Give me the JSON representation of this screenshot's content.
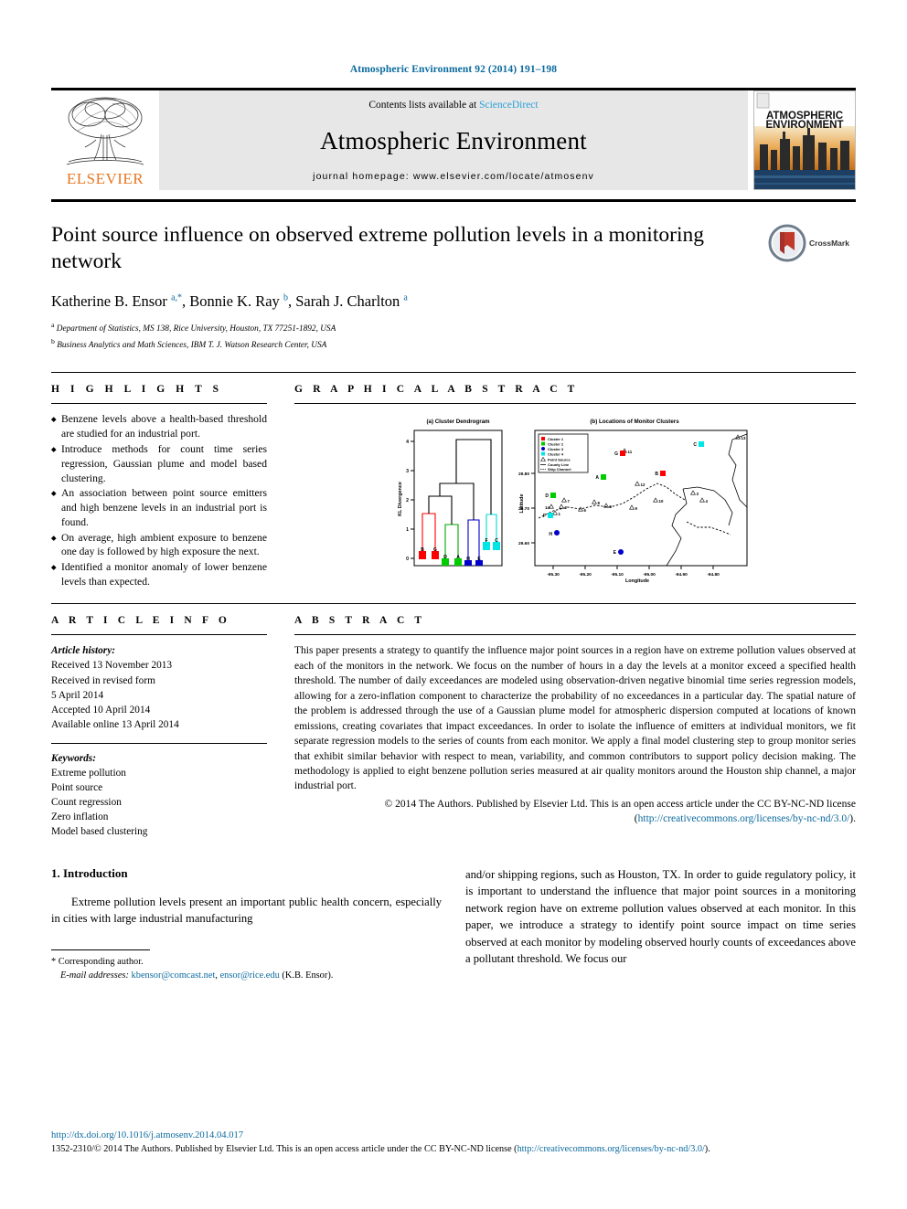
{
  "runhead": "Atmospheric Environment 92 (2014) 191–198",
  "masthead": {
    "publisher": "ELSEVIER",
    "contents_prefix": "Contents lists available at ",
    "contents_link": "ScienceDirect",
    "journal_name": "Atmospheric Environment",
    "homepage": "journal homepage: www.elsevier.com/locate/atmosenv",
    "cover_line1": "ATMOSPHERIC",
    "cover_line2": "ENVIRONMENT"
  },
  "article": {
    "title": "Point source influence on observed extreme pollution levels in a monitoring network",
    "authors_html": "Katherine B. Ensor <sup>a,*</sup>, Bonnie K. Ray <sup>b</sup>, Sarah J. Charlton <sup>a</sup>",
    "affiliation_a": "Department of Statistics, MS 138, Rice University, Houston, TX 77251-1892, USA",
    "affiliation_b": "Business Analytics and Math Sciences, IBM T. J. Watson Research Center, USA",
    "crossmark_label": "CrossMark"
  },
  "highlights": {
    "heading": "H I G H L I G H T S",
    "items": [
      "Benzene levels above a health-based threshold are studied for an industrial port.",
      "Introduce methods for count time series regression, Gaussian plume and model based clustering.",
      "An association between point source emitters and high benzene levels in an industrial port is found.",
      "On average, high ambient exposure to benzene one day is followed by high exposure the next.",
      "Identified a monitor anomaly of lower benzene levels than expected."
    ]
  },
  "graphical_abstract": {
    "heading": "G R A P H I C A L   A B S T R A C T"
  },
  "article_info": {
    "heading": "A R T I C L E   I N F O",
    "history_label": "Article history:",
    "history": [
      "Received 13 November 2013",
      "Received in revised form",
      "5 April 2014",
      "Accepted 10 April 2014",
      "Available online 13 April 2014"
    ],
    "keywords_label": "Keywords:",
    "keywords": [
      "Extreme pollution",
      "Point source",
      "Count regression",
      "Zero inflation",
      "Model based clustering"
    ]
  },
  "abstract": {
    "heading": "A B S T R A C T",
    "text": "This paper presents a strategy to quantify the influence major point sources in a region have on extreme pollution values observed at each of the monitors in the network. We focus on the number of hours in a day the levels at a monitor exceed a specified health threshold. The number of daily exceedances are modeled using observation-driven negative binomial time series regression models, allowing for a zero-inflation component to characterize the probability of no exceedances in a particular day. The spatial nature of the problem is addressed through the use of a Gaussian plume model for atmospheric dispersion computed at locations of known emissions, creating covariates that impact exceedances. In order to isolate the influence of emitters at individual monitors, we fit separate regression models to the series of counts from each monitor. We apply a final model clustering step to group monitor series that exhibit similar behavior with respect to mean, variability, and common contributors to support policy decision making. The methodology is applied to eight benzene pollution series measured at air quality monitors around the Houston ship channel, a major industrial port.",
    "copyright_pre": "© 2014 The Authors. Published by Elsevier Ltd. This is an open access article under the CC BY-NC-ND license (",
    "copyright_link": "http://creativecommons.org/licenses/by-nc-nd/3.0/",
    "copyright_post": ")."
  },
  "introduction": {
    "heading": "1.  Introduction",
    "left_text": "Extreme pollution levels present an important public health concern, especially in cities with large industrial manufacturing",
    "right_text": "and/or shipping regions, such as Houston, TX. In order to guide regulatory policy, it is important to understand the influence that major point sources in a monitoring network region have on extreme pollution values observed at each monitor. In this paper, we introduce a strategy to identify point source impact on time series observed at each monitor by modeling observed hourly counts of exceedances above a pollutant threshold. We focus our"
  },
  "footnote": {
    "corresponding": "* Corresponding author.",
    "email_label": "E-mail addresses:",
    "email1": "kbensor@comcast.net",
    "email_sep": ", ",
    "email2": "ensor@rice.edu",
    "email_suffix": " (K.B. Ensor)."
  },
  "footer": {
    "doi": "http://dx.doi.org/10.1016/j.atmosenv.2014.04.017",
    "issn_pre": "1352-2310/© 2014 The Authors. Published by Elsevier Ltd. This is an open access article under the CC BY-NC-ND license (",
    "issn_link": "http://creativecommons.org/licenses/by-nc-nd/3.0/",
    "issn_post": ")."
  },
  "chart_data": [
    {
      "type": "dendrogram",
      "title": "(a) Cluster Dendrogram",
      "ylabel": "KL Divergence",
      "ytick_labels": [
        "0",
        "1",
        "2",
        "3",
        "4"
      ],
      "ylim": [
        0,
        4.6
      ],
      "leaves": [
        {
          "label": "B",
          "cluster": 1,
          "color": "#FF0000"
        },
        {
          "label": "G",
          "cluster": 1,
          "color": "#FF0000"
        },
        {
          "label": "D",
          "cluster": 2,
          "color": "#00CC00"
        },
        {
          "label": "A",
          "cluster": 2,
          "color": "#00CC00"
        },
        {
          "label": "H",
          "cluster": 3,
          "color": "#0000CC"
        },
        {
          "label": "E",
          "cluster": 3,
          "color": "#0000CC"
        },
        {
          "label": "F",
          "cluster": 4,
          "color": "#00E5E5"
        },
        {
          "label": "C",
          "cluster": 4,
          "color": "#00E5E5"
        }
      ],
      "merge_heights": [
        1.55,
        1.05,
        1.25,
        1.55,
        2.1,
        2.65,
        3.85
      ]
    },
    {
      "type": "scatter",
      "title": "(b) Locations of Monitor Clusters",
      "xlabel": "Longitude",
      "ylabel": "Latitude",
      "xlim": [
        -95.37,
        -94.72
      ],
      "ylim": [
        29.56,
        29.94
      ],
      "xtick_labels": [
        "-95.30",
        "-95.20",
        "-95.10",
        "-95.00",
        "-94.90",
        "-94.80"
      ],
      "ytick_labels": [
        "29.60",
        "29.70",
        "29.80"
      ],
      "legend": [
        {
          "label": "Cluster 1",
          "color": "#FF0000",
          "marker": "square"
        },
        {
          "label": "Cluster 2",
          "color": "#00CC00",
          "marker": "square"
        },
        {
          "label": "Cluster 3",
          "color": "#0000CC",
          "marker": "circle"
        },
        {
          "label": "Cluster 4",
          "color": "#00E5E5",
          "marker": "square"
        },
        {
          "label": "Point Source",
          "color": "#000000",
          "marker": "triangle"
        },
        {
          "label": "County Line",
          "color": "#000000",
          "marker": "line"
        },
        {
          "label": "Ship Channel",
          "color": "#000000",
          "marker": "dashed"
        }
      ],
      "monitors": [
        {
          "label": "A",
          "cluster": 2,
          "x": -95.255,
          "y": 29.8
        },
        {
          "label": "B",
          "cluster": 1,
          "x": -95.033,
          "y": 29.815
        },
        {
          "label": "C",
          "cluster": 4,
          "x": -94.845,
          "y": 29.905
        },
        {
          "label": "D",
          "cluster": 2,
          "x": -95.335,
          "y": 29.745
        },
        {
          "label": "E",
          "cluster": 3,
          "x": -95.125,
          "y": 29.6
        },
        {
          "label": "F",
          "cluster": 4,
          "x": -95.345,
          "y": 29.685
        },
        {
          "label": "G",
          "cluster": 1,
          "x": -95.125,
          "y": 29.865
        },
        {
          "label": "H",
          "cluster": 3,
          "x": -95.325,
          "y": 29.645
        }
      ],
      "point_sources": [
        {
          "label": "1",
          "x": -95.325,
          "y": 29.675
        },
        {
          "label": "2",
          "x": -95.305,
          "y": 29.695
        },
        {
          "label": "3",
          "x": -94.885,
          "y": 29.795
        },
        {
          "label": "4",
          "x": -94.855,
          "y": 29.775
        },
        {
          "label": "5",
          "x": -95.165,
          "y": 29.705
        },
        {
          "label": "6",
          "x": -95.255,
          "y": 29.725
        },
        {
          "label": "7",
          "x": -95.295,
          "y": 29.745
        },
        {
          "label": "8",
          "x": -95.215,
          "y": 29.735
        },
        {
          "label": "9",
          "x": -95.085,
          "y": 29.705
        },
        {
          "label": "10",
          "x": -95.005,
          "y": 29.725
        },
        {
          "label": "11",
          "x": -95.095,
          "y": 29.895
        },
        {
          "label": "12",
          "x": -95.055,
          "y": 29.785
        },
        {
          "label": "13",
          "x": -94.745,
          "y": 29.915
        },
        {
          "label": "14",
          "x": -95.325,
          "y": 29.73
        }
      ]
    }
  ]
}
